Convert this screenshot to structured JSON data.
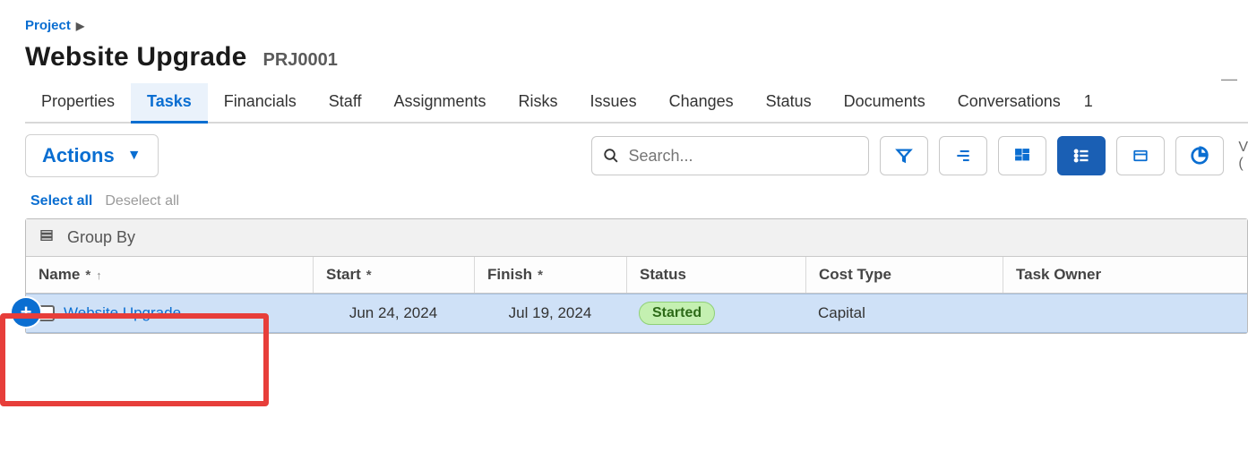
{
  "breadcrumb": {
    "label": "Project"
  },
  "header": {
    "title": "Website Upgrade",
    "code": "PRJ0001"
  },
  "tabs": {
    "items": [
      {
        "label": "Properties"
      },
      {
        "label": "Tasks"
      },
      {
        "label": "Financials"
      },
      {
        "label": "Staff"
      },
      {
        "label": "Assignments"
      },
      {
        "label": "Risks"
      },
      {
        "label": "Issues"
      },
      {
        "label": "Changes"
      },
      {
        "label": "Status"
      },
      {
        "label": "Documents"
      },
      {
        "label": "Conversations"
      }
    ],
    "active_index": 1
  },
  "toolbar": {
    "actions_label": "Actions",
    "search_placeholder": "Search...",
    "right_frag_top": "V",
    "right_frag_bottom": "("
  },
  "selection": {
    "select_all": "Select all",
    "deselect_all": "Deselect all"
  },
  "grid": {
    "group_by_label": "Group By",
    "columns": {
      "name": {
        "label": "Name",
        "required": true,
        "sort": "asc"
      },
      "start": {
        "label": "Start",
        "required": true
      },
      "finish": {
        "label": "Finish",
        "required": true
      },
      "status": {
        "label": "Status"
      },
      "cost": {
        "label": "Cost Type"
      },
      "owner": {
        "label": "Task Owner"
      }
    },
    "rows": [
      {
        "name": "Website Upgrade",
        "start": "Jun 24, 2024",
        "finish": "Jul 19, 2024",
        "status": "Started",
        "cost": "Capital",
        "owner": ""
      }
    ]
  },
  "colors": {
    "accent": "#0a6ed1",
    "primary_button": "#1a5fb4",
    "row_selected": "#cfe1f7",
    "status_pill_bg": "#c4f0b1",
    "status_pill_text": "#2d6a18",
    "highlight": "#e73e3a"
  }
}
